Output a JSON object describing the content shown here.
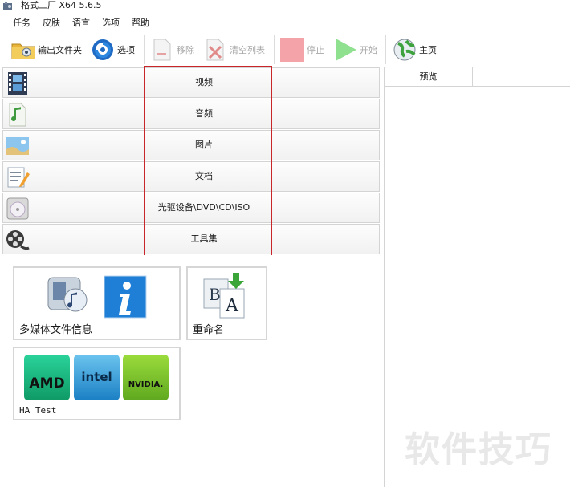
{
  "app": {
    "title": "格式工厂 X64 5.6.5"
  },
  "menu": [
    "任务",
    "皮肤",
    "语言",
    "选项",
    "帮助"
  ],
  "toolbar": {
    "output_folder": "输出文件夹",
    "options": "选项",
    "remove": "移除",
    "clear_list": "清空列表",
    "stop": "停止",
    "start": "开始",
    "home": "主页"
  },
  "categories": [
    {
      "label": "视频",
      "icon": "film-icon"
    },
    {
      "label": "音频",
      "icon": "music-note-icon"
    },
    {
      "label": "图片",
      "icon": "landscape-image-icon"
    },
    {
      "label": "文档",
      "icon": "document-pencil-icon"
    },
    {
      "label": "光驱设备\\DVD\\CD\\ISO",
      "icon": "disc-drive-icon"
    },
    {
      "label": "工具集",
      "icon": "film-reel-icon"
    }
  ],
  "tools": {
    "media_info": "多媒体文件信息",
    "rename": "重命名",
    "ha_test": "HA Test",
    "amd_logo": "AMD",
    "intel_logo": "intel",
    "nvidia_logo": "NVIDIA."
  },
  "preview": {
    "header": "预览"
  },
  "watermark": "软件技巧",
  "colors": {
    "highlight": "#c9262c",
    "stop_red": "#f4a3a8",
    "start_green": "#8fe08f"
  }
}
